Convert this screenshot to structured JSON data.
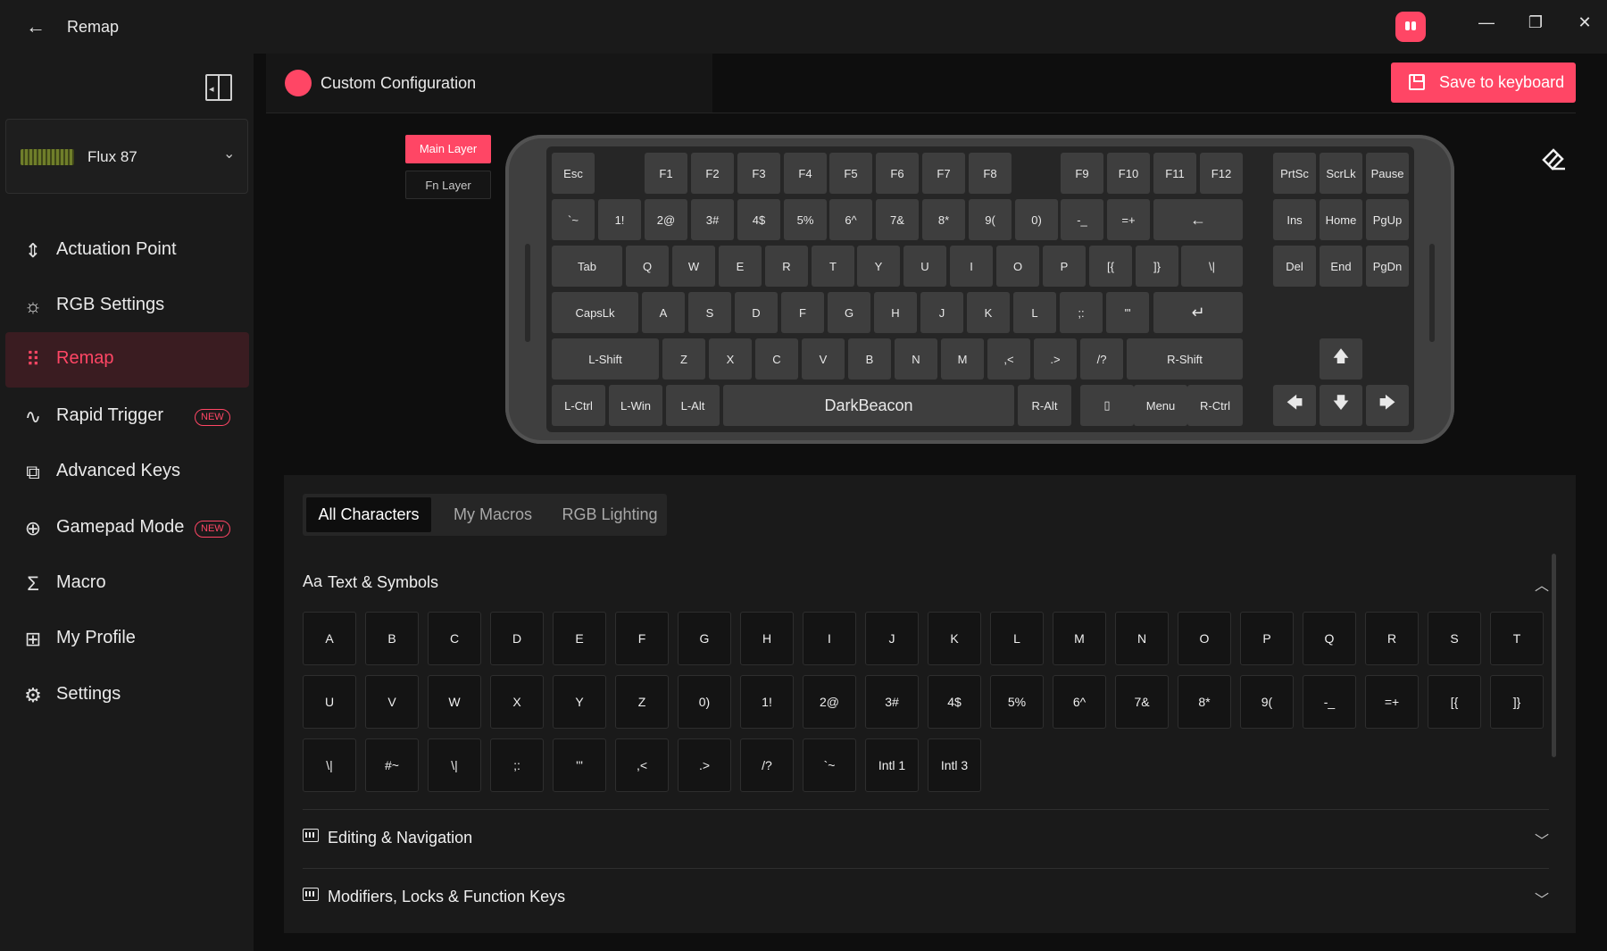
{
  "window": {
    "title": "Remap",
    "back_icon": "arrow-left-icon",
    "controls": {
      "minimize": "—",
      "restore": "❐",
      "close": "✕"
    }
  },
  "sidebar": {
    "device": {
      "name": "Flux 87"
    },
    "items": [
      {
        "label": "Actuation Point",
        "icon": "⇕",
        "badge": ""
      },
      {
        "label": "RGB Settings",
        "icon": "☼",
        "badge": ""
      },
      {
        "label": "Remap",
        "icon": "⠿",
        "badge": ""
      },
      {
        "label": "Rapid Trigger",
        "icon": "∿",
        "badge": "NEW"
      },
      {
        "label": "Advanced Keys",
        "icon": "⧉",
        "badge": ""
      },
      {
        "label": "Gamepad Mode",
        "icon": "⊕",
        "badge": "NEW"
      },
      {
        "label": "Macro",
        "icon": "Σ",
        "badge": ""
      },
      {
        "label": "My Profile",
        "icon": "⊞",
        "badge": ""
      },
      {
        "label": "Settings",
        "icon": "⚙",
        "badge": ""
      }
    ],
    "active_index": 2
  },
  "header": {
    "config_name": "Custom Configuration",
    "save_label": "Save to keyboard"
  },
  "layers": {
    "main": "Main Layer",
    "fn": "Fn Layer",
    "active": "main"
  },
  "keyboard": {
    "rows": [
      [
        "Esc",
        "F1",
        "F2",
        "F3",
        "F4",
        "F5",
        "F6",
        "F7",
        "F8",
        "F9",
        "F10",
        "F11",
        "F12",
        "PrtSc",
        "ScrLk",
        "Pause"
      ],
      [
        "`~",
        "1!",
        "2@",
        "3#",
        "4$",
        "5%",
        "6^",
        "7&",
        "8*",
        "9(",
        "0)",
        "-_",
        "=+",
        "←",
        "Ins",
        "Home",
        "PgUp"
      ],
      [
        "Tab",
        "Q",
        "W",
        "E",
        "R",
        "T",
        "Y",
        "U",
        "I",
        "O",
        "P",
        "[{",
        "]}",
        "\\|",
        "Del",
        "End",
        "PgDn"
      ],
      [
        "CapsLk",
        "A",
        "S",
        "D",
        "F",
        "G",
        "H",
        "J",
        "K",
        "L",
        ";:",
        "'\"",
        "↵"
      ],
      [
        "L-Shift",
        "Z",
        "X",
        "C",
        "V",
        "B",
        "N",
        "M",
        ",<",
        ".>",
        "/?",
        "R-Shift",
        "🡅"
      ],
      [
        "L-Ctrl",
        "L-Win",
        "L-Alt",
        "DarkBeacon",
        "R-Alt",
        "▯",
        "Menu",
        "R-Ctrl",
        "🡄",
        "🡇",
        "🡆"
      ]
    ]
  },
  "panel": {
    "tabs": [
      "All Characters",
      "My Macros",
      "RGB Lighting"
    ],
    "active_tab": 0,
    "sections": [
      {
        "title": "Text & Symbols",
        "icon": "Aa",
        "expanded": true
      },
      {
        "title": "Editing & Navigation",
        "icon": "keyboard-icon",
        "expanded": false
      },
      {
        "title": "Modifiers, Locks & Function Keys",
        "icon": "keyboard-icon",
        "expanded": false
      }
    ],
    "characters": [
      [
        "A",
        "B",
        "C",
        "D",
        "E",
        "F",
        "G",
        "H",
        "I",
        "J",
        "K",
        "L",
        "M",
        "N",
        "O",
        "P",
        "Q",
        "R",
        "S",
        "T"
      ],
      [
        "U",
        "V",
        "W",
        "X",
        "Y",
        "Z",
        "0)",
        "1!",
        "2@",
        "3#",
        "4$",
        "5%",
        "6^",
        "7&",
        "8*",
        "9(",
        "-_",
        "=+",
        "[{",
        "]}"
      ],
      [
        "\\|",
        "#~",
        "\\|",
        ";:",
        "'\"",
        ",<",
        ".>",
        "/?",
        "`~",
        "Intl 1",
        "Intl 3"
      ]
    ]
  },
  "colors": {
    "accent": "#ff4665",
    "background": "#0e0e0e",
    "sidebar": "#1a1a1a",
    "key": "#3e3e3e"
  }
}
